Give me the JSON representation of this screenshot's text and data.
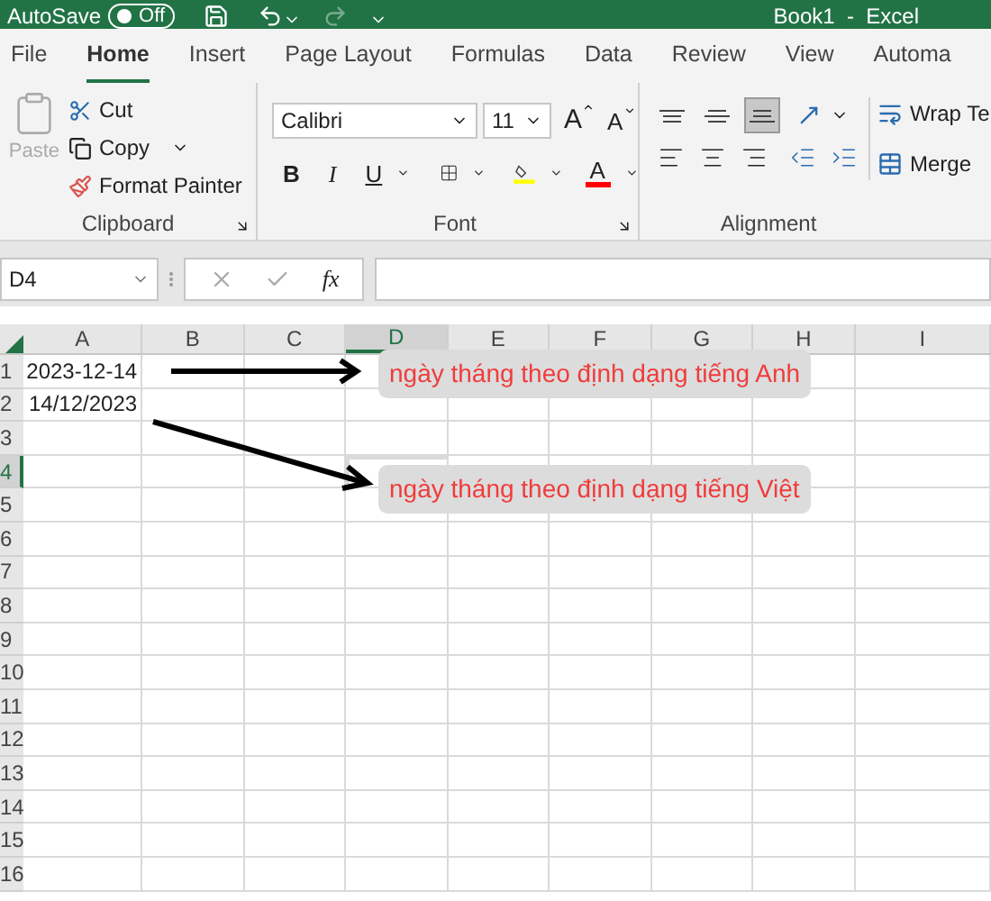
{
  "title_bar": {
    "autosave_label": "AutoSave",
    "autosave_toggle": {
      "label": "Off",
      "on": false
    },
    "title": "Book1  -  Excel"
  },
  "tabs": [
    {
      "label": "File",
      "selected": false
    },
    {
      "label": "Home",
      "selected": true
    },
    {
      "label": "Insert",
      "selected": false
    },
    {
      "label": "Page Layout",
      "selected": false
    },
    {
      "label": "Formulas",
      "selected": false
    },
    {
      "label": "Data",
      "selected": false
    },
    {
      "label": "Review",
      "selected": false
    },
    {
      "label": "View",
      "selected": false
    },
    {
      "label": "Automa",
      "selected": false
    }
  ],
  "ribbon": {
    "clipboard": {
      "paste": {
        "label": "Paste",
        "disabled": true
      },
      "cut": "Cut",
      "copy": "Copy",
      "format_painter": "Format Painter",
      "group_label": "Clipboard"
    },
    "font": {
      "font_name": "Calibri",
      "font_size": "11",
      "grow": "A",
      "shrink": "A",
      "bold": "B",
      "italic": "I",
      "underline": "U",
      "font_color": "A",
      "group_label": "Font"
    },
    "alignment": {
      "vertical": [
        {
          "kind": "top",
          "selected": false
        },
        {
          "kind": "middle",
          "selected": false
        },
        {
          "kind": "bottom",
          "selected": true
        }
      ],
      "wrap_text": "Wrap Te",
      "merge": "Merge",
      "group_label": "Alignment"
    }
  },
  "formula_bar": {
    "name_box": "D4",
    "function_label": "fx"
  },
  "sheet": {
    "columns": [
      {
        "label": "A",
        "selected": false
      },
      {
        "label": "B",
        "selected": false
      },
      {
        "label": "C",
        "selected": false
      },
      {
        "label": "D",
        "selected": true
      },
      {
        "label": "E",
        "selected": false
      },
      {
        "label": "F",
        "selected": false
      },
      {
        "label": "G",
        "selected": false
      },
      {
        "label": "H",
        "selected": false
      },
      {
        "label": "I",
        "selected": false
      }
    ],
    "rows": [
      {
        "label": "1",
        "selected": false,
        "cells": [
          "2023-12-14"
        ]
      },
      {
        "label": "2",
        "selected": false,
        "cells": [
          "14/12/2023"
        ]
      },
      {
        "label": "3",
        "selected": false
      },
      {
        "label": "4",
        "selected": true
      },
      {
        "label": "5",
        "selected": false
      },
      {
        "label": "6",
        "selected": false
      },
      {
        "label": "7",
        "selected": false
      },
      {
        "label": "8",
        "selected": false
      },
      {
        "label": "9",
        "selected": false
      },
      {
        "label": "10",
        "selected": false
      },
      {
        "label": "11",
        "selected": false
      },
      {
        "label": "12",
        "selected": false
      },
      {
        "label": "13",
        "selected": false
      },
      {
        "label": "14",
        "selected": false
      },
      {
        "label": "15",
        "selected": false
      },
      {
        "label": "16",
        "selected": false
      }
    ]
  },
  "annotations": [
    {
      "text": "ngày tháng theo định dạng tiếng Anh"
    },
    {
      "text": "ngày tháng theo định dạng tiếng Việt"
    }
  ]
}
